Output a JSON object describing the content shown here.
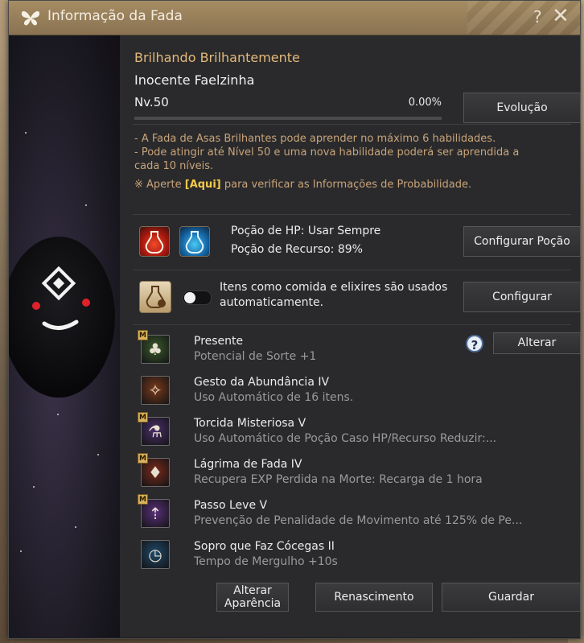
{
  "window": {
    "title": "Informação da Fada",
    "help_symbol": "?",
    "close_symbol": "✕"
  },
  "fairy": {
    "title": "Brilhando Brilhantemente",
    "name": "Inocente Faelzinha",
    "level": "Nv.50",
    "exp_percent": "0.00%",
    "exp_fraction": 0.0,
    "evolve_button": "Evolução"
  },
  "info": {
    "line1": "- A Fada de Asas Brilhantes pode aprender no máximo 6 habilidades.",
    "line2": "- Pode atingir até Nível 50 e uma nova habilidade poderá ser aprendida a",
    "line3": "cada 10 níveis.",
    "prob_prefix": "※ Aperte ",
    "prob_link": "[Aqui]",
    "prob_suffix": " para verificar as Informações de Probabilidade."
  },
  "potion": {
    "hp_label": "Poção de HP: Usar Sempre",
    "resource_label": "Poção de Recurso: 89%",
    "configure_button": "Configurar Poção"
  },
  "auto_use": {
    "line1": "Itens como comida e elixires são usados",
    "line2": "automaticamente.",
    "configure_button": "Configurar",
    "toggle_on": false
  },
  "skills_section": {
    "help_symbol": "?",
    "change_button": "Alterar"
  },
  "skills": [
    {
      "badge": "M",
      "name": "Presente",
      "desc": "Potencial de Sorte +1",
      "icon": "clover-icon",
      "color": "#3a5a2a"
    },
    {
      "badge": "",
      "name": "Gesto da Abundância IV",
      "desc": "Uso Automático de 16 itens.",
      "icon": "fairy-gesture-icon",
      "color": "#7a3a1a"
    },
    {
      "badge": "M",
      "name": "Torcida Misteriosa V",
      "desc": "Uso Automático de Poção Caso HP/Recurso Reduzir:...",
      "icon": "potion-plus-icon",
      "color": "#4a2f6a"
    },
    {
      "badge": "M",
      "name": "Lágrima de Fada IV",
      "desc": "Recupera EXP Perdida na Morte: Recarga de 1 hora",
      "icon": "tear-icon",
      "color": "#7a2a1a"
    },
    {
      "badge": "M",
      "name": "Passo Leve V",
      "desc": "Prevenção de Penalidade de Movimento até 125% de Pe...",
      "icon": "light-step-icon",
      "color": "#5a2f7a"
    },
    {
      "badge": "",
      "name": "Sopro que Faz Cócegas II",
      "desc": "Tempo de Mergulho +10s",
      "icon": "breath-clock-icon",
      "color": "#1f4a6a"
    }
  ],
  "footer": {
    "appearance_button_line1": "Alterar",
    "appearance_button_line2": "Aparência",
    "rebirth_button": "Renascimento",
    "store_button": "Guardar"
  },
  "colors": {
    "title_bar": "#a58c63",
    "accent_gold": "#e4b97a",
    "info_text": "#c8a47a",
    "link": "#f3c94a"
  }
}
